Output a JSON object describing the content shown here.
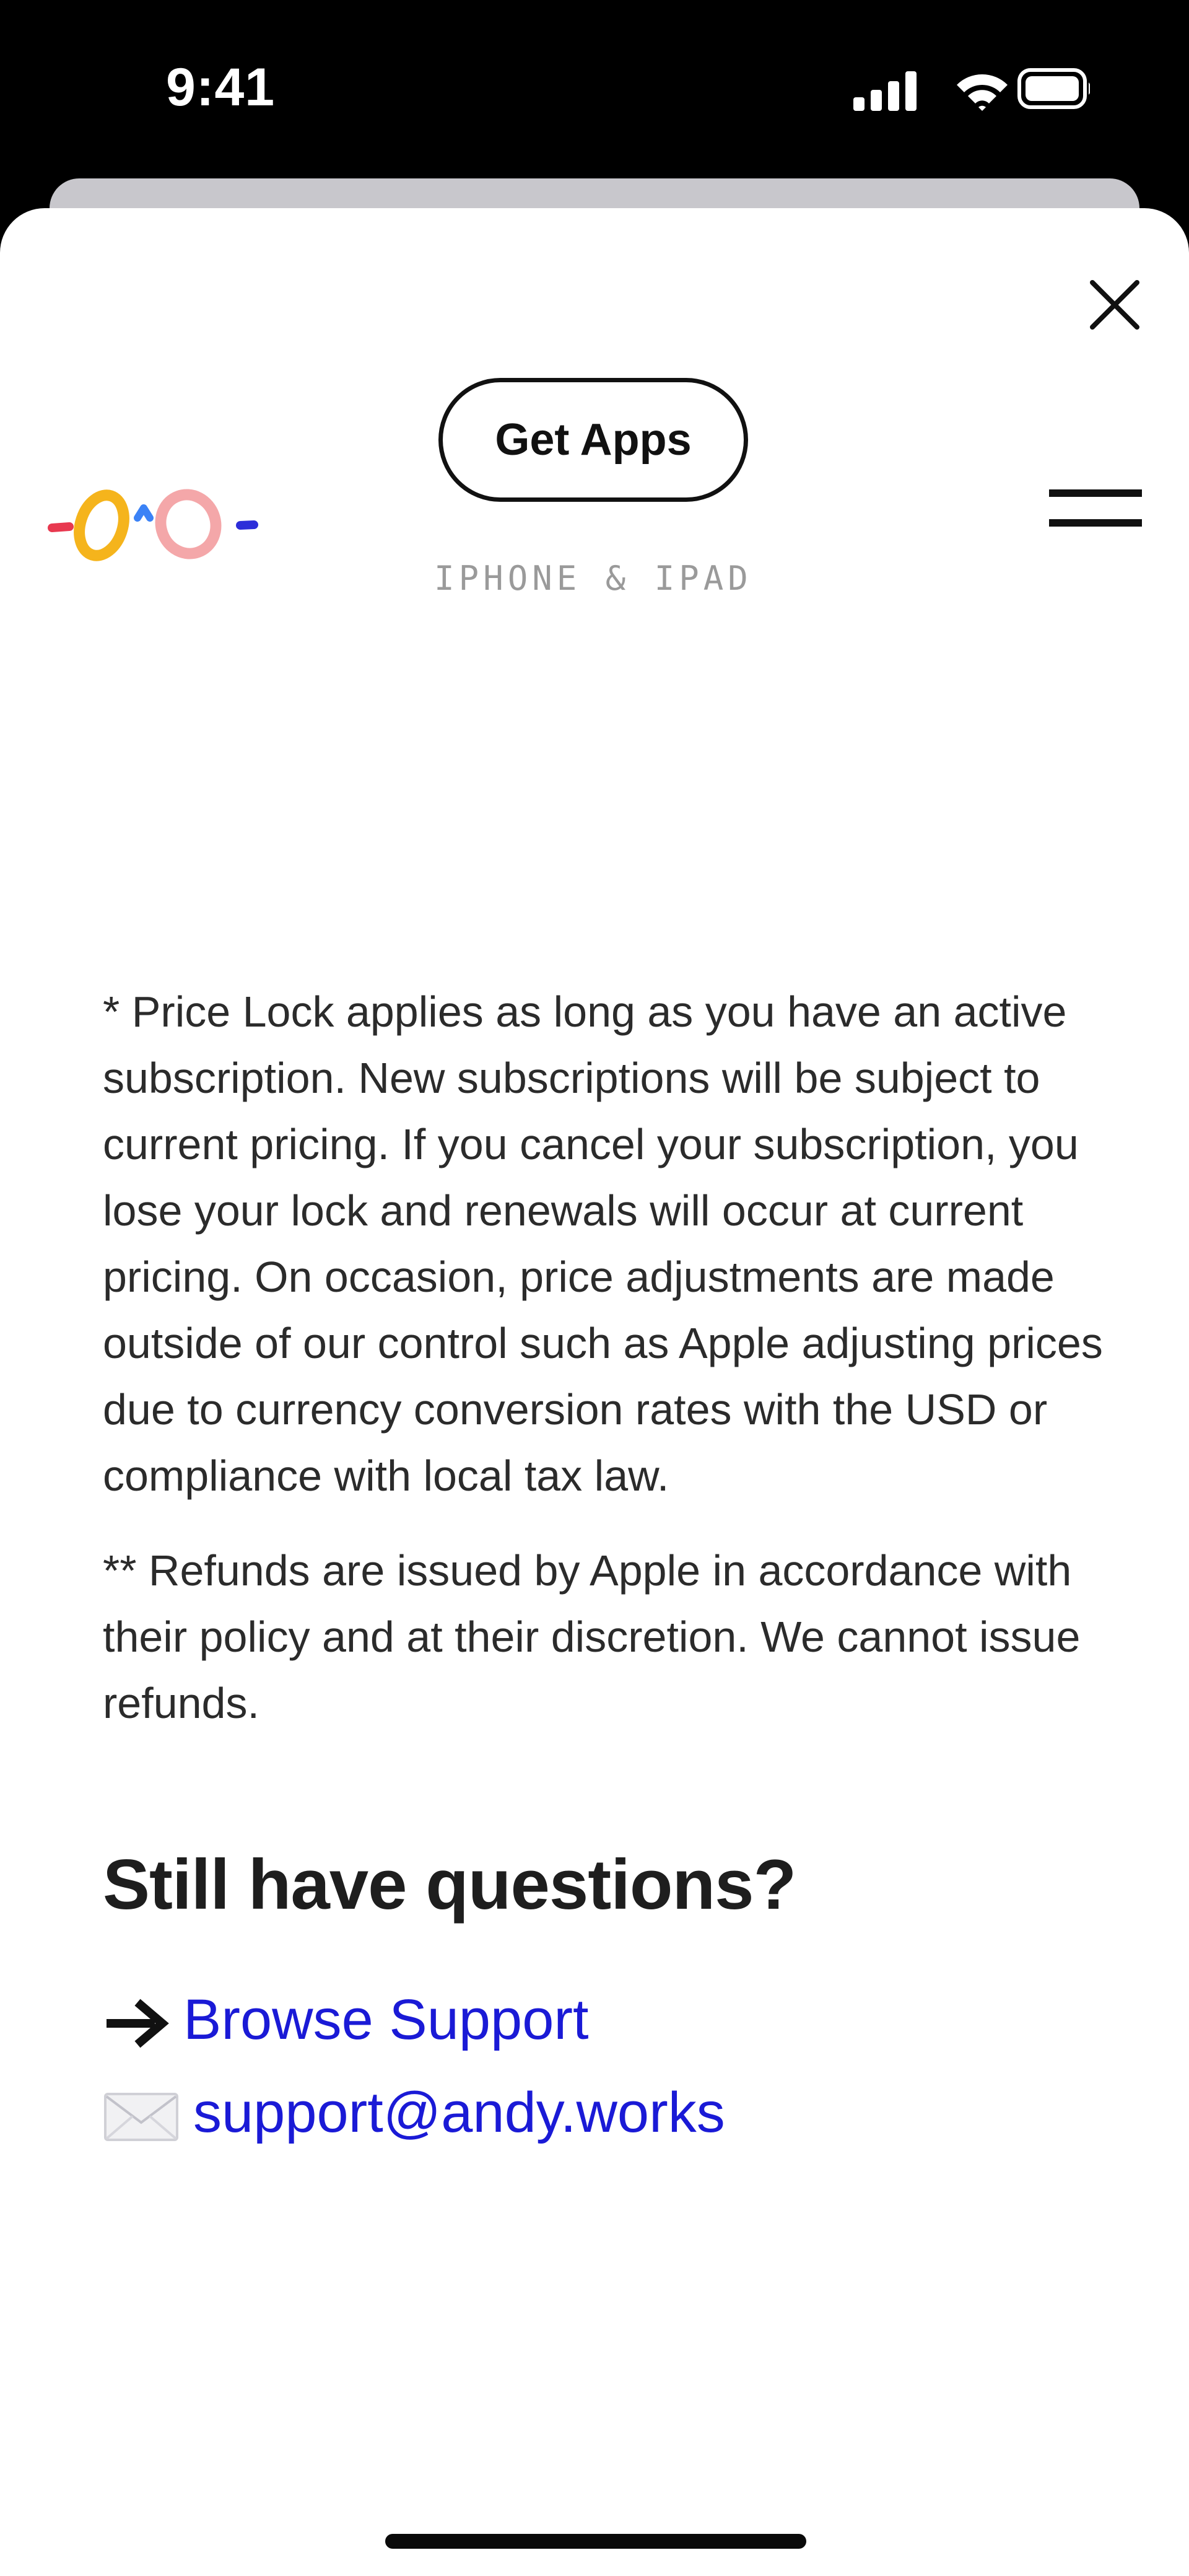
{
  "status_bar": {
    "time": "9:41",
    "icons": [
      "cellular-signal-icon",
      "wifi-icon",
      "battery-icon"
    ]
  },
  "header": {
    "close_icon": "close-icon",
    "logo_icon": "andy-works-logo-icon",
    "get_apps_label": "Get Apps",
    "platform_label": "IPHONE & IPAD",
    "menu_icon": "hamburger-menu-icon"
  },
  "main": {
    "price_lock_note": "* Price Lock applies as long as you have an active subscription. New subscriptions will be subject to current pricing. If you cancel your subscription, you lose your lock and renewals will occur at current pricing. On occasion, price adjustments are made outside of our control such as Apple adjusting prices due to currency conversion rates with the USD or compliance with local tax law.",
    "refund_note": "** Refunds are issued by Apple in accordance with their policy and at their discretion. We cannot issue refunds.",
    "questions_heading": "Still have questions?",
    "links": [
      {
        "icon": "arrow-right-icon",
        "label": "Browse Support"
      },
      {
        "icon": "envelope-icon",
        "label": "support@andy.works"
      }
    ]
  },
  "colors": {
    "link": "#1a1ad6",
    "body_text": "#2b2b2b",
    "platform_label": "#9a9a9a",
    "logo_yellow": "#f5b41c",
    "logo_pink": "#f4a7a9",
    "logo_red": "#e8384f",
    "logo_blue": "#3b82f6",
    "logo_navy": "#2d2ed9"
  }
}
